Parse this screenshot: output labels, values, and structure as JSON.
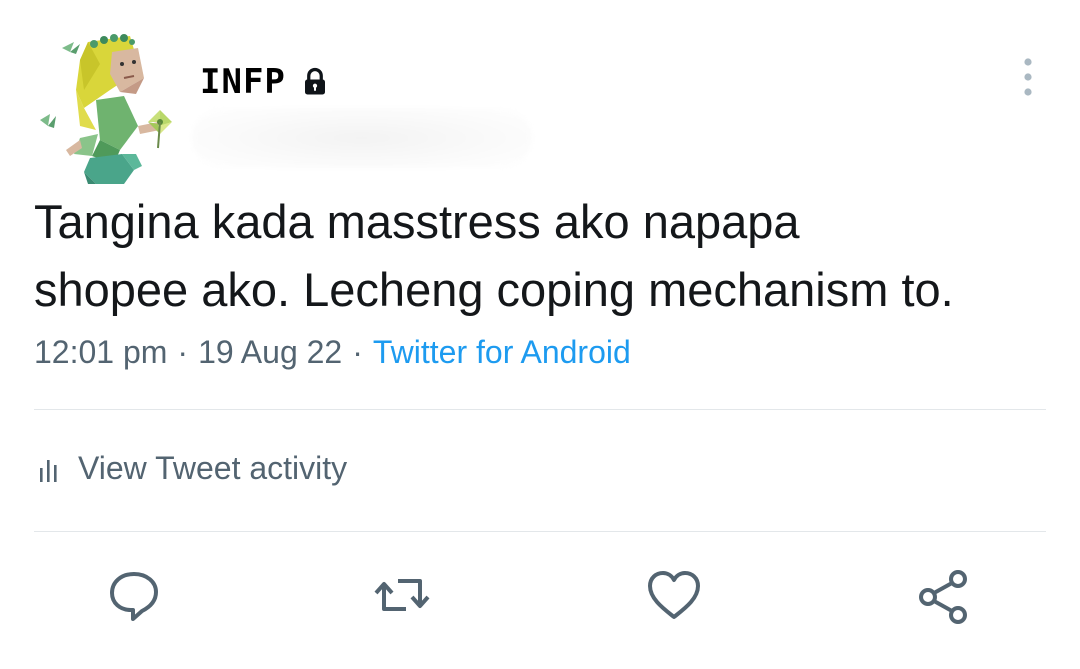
{
  "user": {
    "display_name": "INFP",
    "avatar_icon": "low-poly-figure-avatar",
    "protected_icon": "lock-icon"
  },
  "tweet": {
    "text_line1": "Tangina kada masstress ako napapa",
    "text_line2": "shopee ako. Lecheng coping mechanism to.",
    "time": "12:01 pm",
    "sep1": "·",
    "date": "19 Aug 22",
    "sep2": "·",
    "source": "Twitter for Android"
  },
  "activity": {
    "label": "View Tweet activity",
    "icon": "bar-chart-icon"
  },
  "actions": {
    "reply_icon": "reply-icon",
    "retweet_icon": "retweet-icon",
    "like_icon": "heart-icon",
    "share_icon": "share-icon"
  },
  "colors": {
    "text": "#14171a",
    "muted": "#536471",
    "accent": "#1d9bf0",
    "divider": "#e3e7ea"
  }
}
